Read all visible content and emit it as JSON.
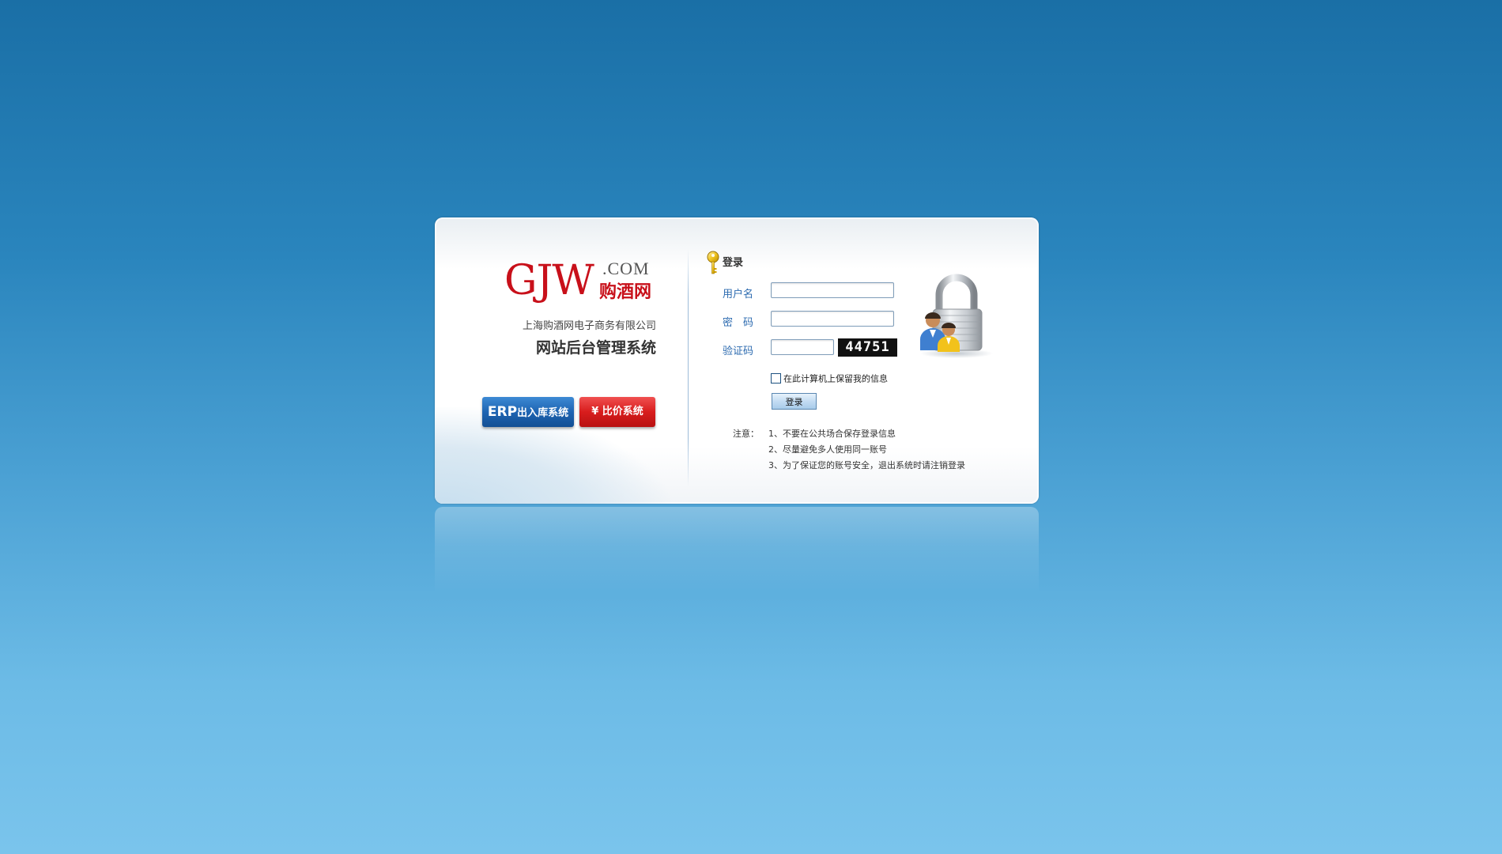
{
  "logo": {
    "latin": "GJW",
    "domain": ".COM",
    "chinese": "购酒网",
    "brand_color": "#c8101a"
  },
  "left": {
    "company": "上海购酒网电子商务有限公司",
    "system_title": "网站后台管理系统",
    "erp_button": {
      "prefix": "ERP",
      "label": "出入库系统",
      "color": "#1e64b2"
    },
    "price_button": {
      "icon": "yen-icon",
      "symbol": "¥",
      "label": "比价系统",
      "color": "#d81d1d"
    }
  },
  "login": {
    "title": "登录",
    "title_icon": "key-icon",
    "username_label": "用户名",
    "username_value": "",
    "password_label": "密　码",
    "password_value": "",
    "captcha_label": "验证码",
    "captcha_value": "",
    "captcha_code": "44751",
    "remember_label": "在此计算机上保留我的信息",
    "remember_checked": false,
    "submit_label": "登录"
  },
  "notice": {
    "label": "注意：",
    "items": [
      "1、不要在公共场合保存登录信息",
      "2、尽量避免多人使用同一账号",
      "3、为了保证您的账号安全，退出系统时请注销登录"
    ]
  },
  "decor": {
    "lock_icon": "lock-users-icon"
  }
}
